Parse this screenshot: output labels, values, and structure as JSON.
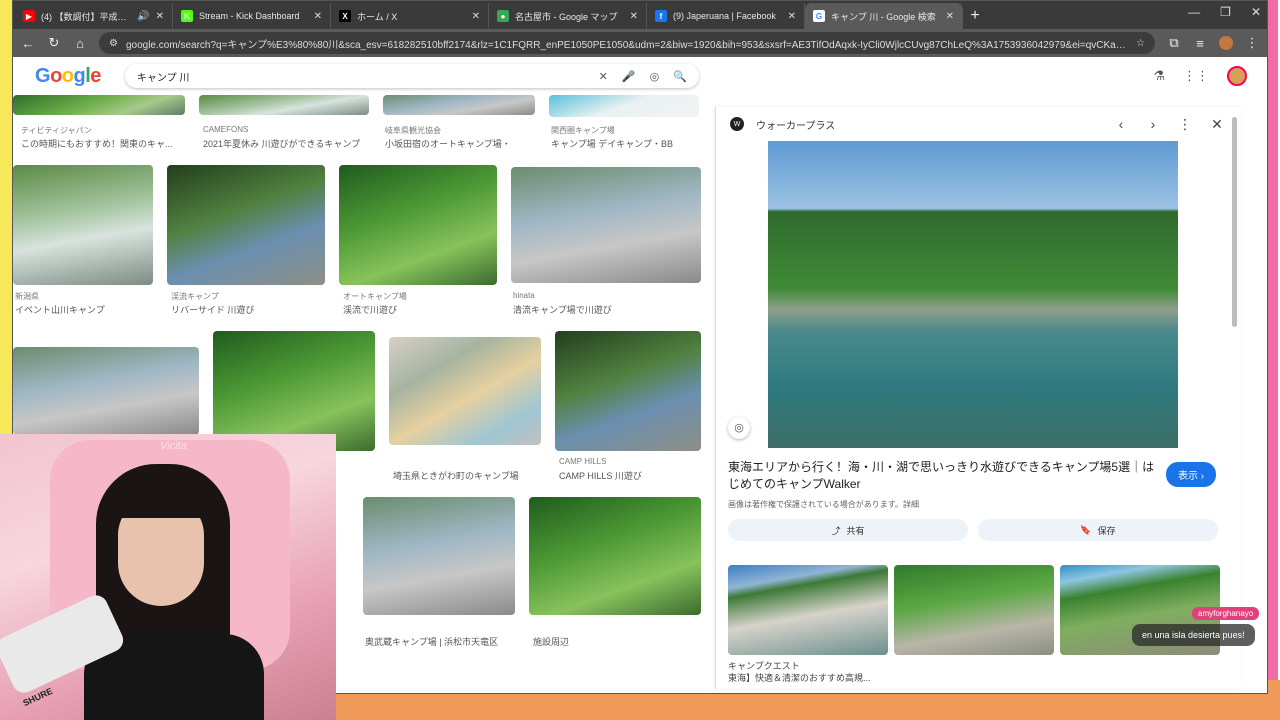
{
  "tabs": [
    {
      "label": "(4) 【数調付】平成アニソンメドレ",
      "icon": "youtube-icon",
      "color": "#ff0000",
      "glyph": "▶",
      "audio": "🔊"
    },
    {
      "label": "Stream - Kick Dashboard",
      "icon": "kick-icon",
      "color": "#53fc18",
      "glyph": "K"
    },
    {
      "label": "ホーム / X",
      "icon": "x-icon",
      "color": "#000000",
      "glyph": "X"
    },
    {
      "label": "名古屋市 - Google マップ",
      "icon": "maps-icon",
      "color": "#34a853",
      "glyph": "●"
    },
    {
      "label": "(9) Japeruana | Facebook",
      "icon": "facebook-icon",
      "color": "#1877f2",
      "glyph": "f"
    },
    {
      "label": "キャンプ 川 - Google 検索",
      "icon": "google-icon",
      "color": "#ffffff",
      "glyph": "G",
      "active": true
    }
  ],
  "toolbar": {
    "url": "google.com/search?q=キャンプ%E3%80%80川&sca_esv=618282510bff2174&rlz=1C1FQRR_enPE1050PE1050&udm=2&biw=1920&bih=953&sxsrf=AE3TifOdAqxk-IyCli0WjlcCUvg87ChLeQ%3A1753936042979&ei=qvCKaJzDO5Le2roPkdDF4Q4&..."
  },
  "google": {
    "logo": [
      "G",
      "o",
      "o",
      "g",
      "l",
      "e"
    ],
    "query": "キャンプ 川"
  },
  "results": {
    "row0_captions": [
      {
        "src": "ティビティジャパン",
        "title": "この時期にもおすすめ！関東のキャ..."
      },
      {
        "src": "CAMEFONS",
        "title": "2021年夏休み 川遊びができるキャンプ"
      },
      {
        "src": "岐阜県観光協会",
        "title": "小坂田宿のオートキャンプ場・"
      },
      {
        "src": "関西圏キャンプ場",
        "title": "キャンプ場 デイキャンプ・BB"
      }
    ],
    "row1_captions": [
      {
        "src": "新潟県",
        "title": "イベント山川キャンプ"
      },
      {
        "src": "渓流キャンプ",
        "title": "リバーサイド 川遊び"
      },
      {
        "src": "オートキャンプ場",
        "title": "渓流で川遊び"
      },
      {
        "src": "hinata",
        "title": "清流キャンプ場で川遊び"
      }
    ],
    "row2_captions": [
      {
        "src": "",
        "title": "埼玉県ときがわ町のキャンプ場"
      },
      {
        "src": "CAMP HILLS",
        "title": "CAMP HILLS 川遊び"
      }
    ],
    "row3_captions": [
      {
        "src": "",
        "title": "奥武蔵キャンプ場 | 浜松市天竜区"
      },
      {
        "src": "",
        "title": "施設周辺"
      }
    ]
  },
  "panel": {
    "site": "ウォーカープラス",
    "title": "東海エリアから行く！海・川・湖で思いっきり水遊びできるキャンプ場5選｜はじめてのキャンプWalker",
    "view_label": "表示 ›",
    "note": "画像は著作権で保護されている場合があります。詳細",
    "share_label": "共有",
    "save_label": "保存",
    "related_src": "キャンプクエスト",
    "related_title": "東海】快適＆清潔のおすすめ高規..."
  },
  "chat": {
    "user": "amyforghanayo",
    "message": "en una isla desierta pues!"
  },
  "webcam": {
    "logo": "Vicita",
    "mic_brand": "SHURE"
  }
}
